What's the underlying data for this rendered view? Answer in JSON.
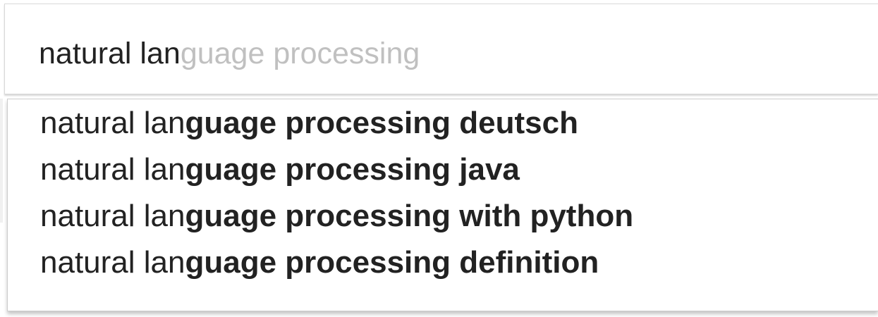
{
  "search": {
    "typed_text": "natural lan",
    "autocomplete_completion": "guage processing"
  },
  "suggestions": [
    {
      "prefix": "natural lan",
      "completion": "guage processing deutsch"
    },
    {
      "prefix": "natural lan",
      "completion": "guage processing java"
    },
    {
      "prefix": "natural lan",
      "completion": "guage processing with python"
    },
    {
      "prefix": "natural lan",
      "completion": "guage processing definition"
    }
  ],
  "colors": {
    "text": "#222222",
    "ghost_text": "#c0c0c0",
    "border": "#d9d9d9",
    "dropdown_border": "#cccccc",
    "background": "#ffffff"
  }
}
